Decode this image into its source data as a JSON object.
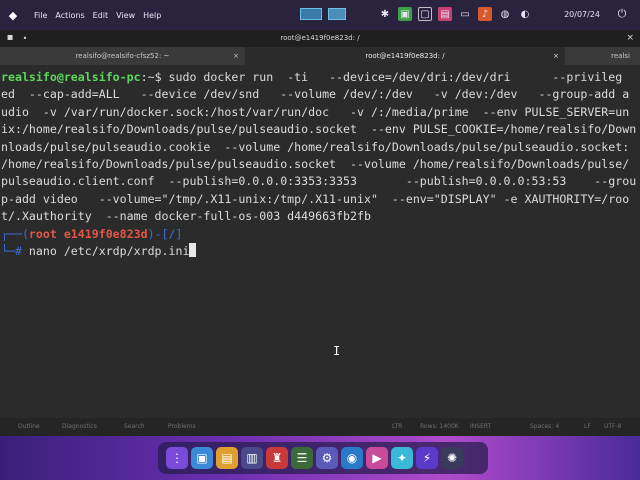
{
  "menubar": {
    "items": [
      "File",
      "Actions",
      "Edit",
      "View",
      "Help"
    ],
    "clock": "20/07/24"
  },
  "window": {
    "title": "root@e1419f0e823d: /",
    "tabs": [
      {
        "label": "realsifo@realsifo-cfsz52: ~"
      },
      {
        "label": "root@e1419f0e823d: /"
      },
      {
        "label": "realsi"
      }
    ]
  },
  "terminal": {
    "lines": [
      {
        "user": "realsifo@realsifo-pc",
        "rest": ":~$ sudo docker run  -ti   --device=/dev/dri:/dev/dri      --privileg"
      },
      {
        "text": "ed  --cap-add=ALL   --device /dev/snd   --volume /dev/:/dev   -v /dev:/dev   --group-add a"
      },
      {
        "text": "udio  -v /var/run/docker.sock:/host/var/run/doc   -v /:/media/prime  --env PULSE_SERVER=un"
      },
      {
        "text": "ix:/home/realsifo/Downloads/pulse/pulseaudio.socket  --env PULSE_COOKIE=/home/realsifo/Down"
      },
      {
        "text": "nloads/pulse/pulseaudio.cookie  --volume /home/realsifo/Downloads/pulse/pulseaudio.socket:"
      },
      {
        "text": "/home/realsifo/Downloads/pulse/pulseaudio.socket  --volume /home/realsifo/Downloads/pulse/"
      },
      {
        "text": "pulseaudio.client.conf  --publish=0.0.0.0:3353:3353       --publish=0.0.0.0:53:53    --grou"
      },
      {
        "text": "p-add video   --volume=\"/tmp/.X11-unix:/tmp/.X11-unix\"  --env=\"DISPLAY\" -e XAUTHORITY=/roo"
      },
      {
        "text": "t/.Xauthority  --name docker-full-os-003 d449663fb2fb"
      }
    ],
    "root_prompt": {
      "open": "┌──(",
      "user": "root",
      "host": " e1419f0e823d",
      "close": ")-[/]"
    },
    "command_prefix": "└─# ",
    "command": "nano /etc/xrdp/xrdp.ini"
  },
  "statusbar": {
    "items": [
      "Outline",
      "Diagnostics",
      "Search",
      "Problems",
      "LTR",
      "Rows: 1400K",
      "INSERT",
      "Spaces: 4",
      "LF",
      "UTF-8"
    ]
  },
  "colors": {
    "terminal_bg": "#2b2b2b",
    "user_prompt": "#5dd85d",
    "root_user": "#e0574a",
    "root_frame": "#3b6fd8"
  }
}
